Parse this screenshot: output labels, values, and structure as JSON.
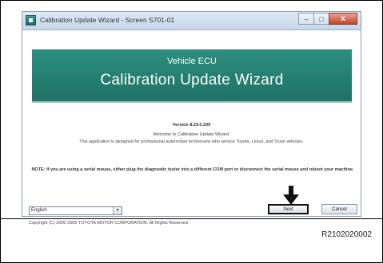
{
  "window": {
    "title": "Calibration Update Wizard - Screen S701-01",
    "buttons": {
      "minimize": "–",
      "maximize": "□",
      "close": "x"
    }
  },
  "header": {
    "subtitle": "Vehicle ECU",
    "title": "Calibration Update Wizard"
  },
  "body": {
    "version": "Version 8.29.0.209",
    "welcome": "Welcome to Calibration Update Wizard.",
    "designed": "This application is designed for professional automotive technicians who service Toyota, Lexus, and Scion vehicles.",
    "note": "NOTE: If you are using a serial mouse, either plug the diagnostic tester into a different COM port or disconnect the serial mouse and reboot your machine."
  },
  "footer": {
    "language": "English",
    "copyright": "Copyright (C) 2000-2005 TOYOTA MOTOR CORPORATION. All Rights Reserved.",
    "next_label": "Next",
    "cancel_label": "Cancel"
  },
  "reference_code": "R2102020002",
  "icons": [
    "app-icon",
    "dropdown-arrow-icon",
    "pointer-arrow-icon"
  ],
  "colors": {
    "header": "#2c8e7f",
    "close_button": "#c2432a",
    "frame": "#000000"
  }
}
